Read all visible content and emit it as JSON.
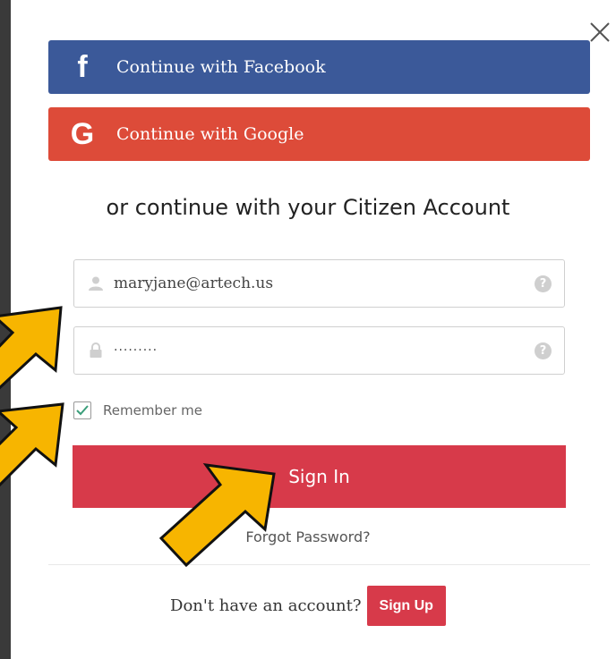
{
  "modal": {
    "close_icon": "close-icon",
    "facebook": {
      "label": "Continue with Facebook",
      "icon": "f",
      "color": "#3b5999"
    },
    "google": {
      "label": "Continue with Google",
      "icon": "G",
      "color": "#dd4b39"
    },
    "or_text": "or continue with your Citizen Account",
    "email": {
      "value": "maryjane@artech.us",
      "icon": "user-icon"
    },
    "password": {
      "value": "·········",
      "icon": "lock-icon"
    },
    "help_icon": "?",
    "remember": {
      "label": "Remember me",
      "checked": true
    },
    "sign_in_label": "Sign In",
    "forgot_password_label": "Forgot Password?",
    "signup_prompt": "Don't have an account?",
    "sign_up_label": "Sign Up",
    "accent_color": "#d73a4a"
  },
  "annotations": {
    "arrow_color": "#f7b500",
    "arrow_icon": "arrow-annotation-icon"
  }
}
